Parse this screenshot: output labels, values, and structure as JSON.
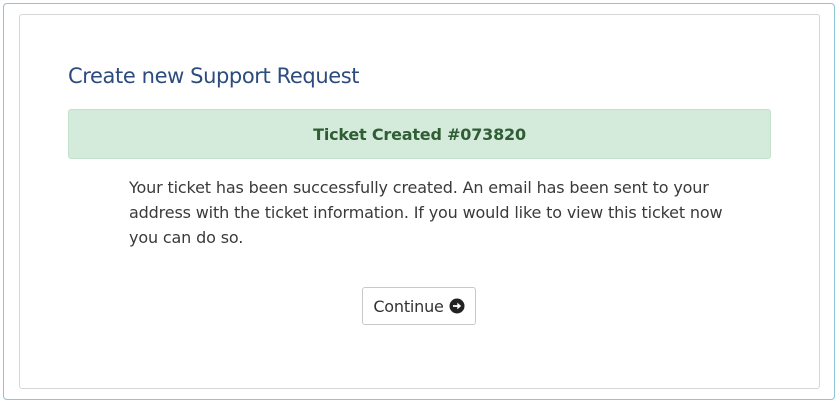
{
  "page": {
    "title": "Create new Support Request"
  },
  "alert": {
    "text": "Ticket Created #073820"
  },
  "message": {
    "lines": [
      "Your ticket has been successfully created. An email has been sent to your",
      "address with the ticket information. If you would like to view this ticket now",
      "you can do so."
    ]
  },
  "actions": {
    "continue_label": "Continue",
    "continue_icon": "circle-arrow-right-icon"
  },
  "colors": {
    "title": "#2c4c7e",
    "alert_background": "#d4ebdb",
    "alert_text": "#2f5d34",
    "frame_border": "#8fc3d6"
  }
}
